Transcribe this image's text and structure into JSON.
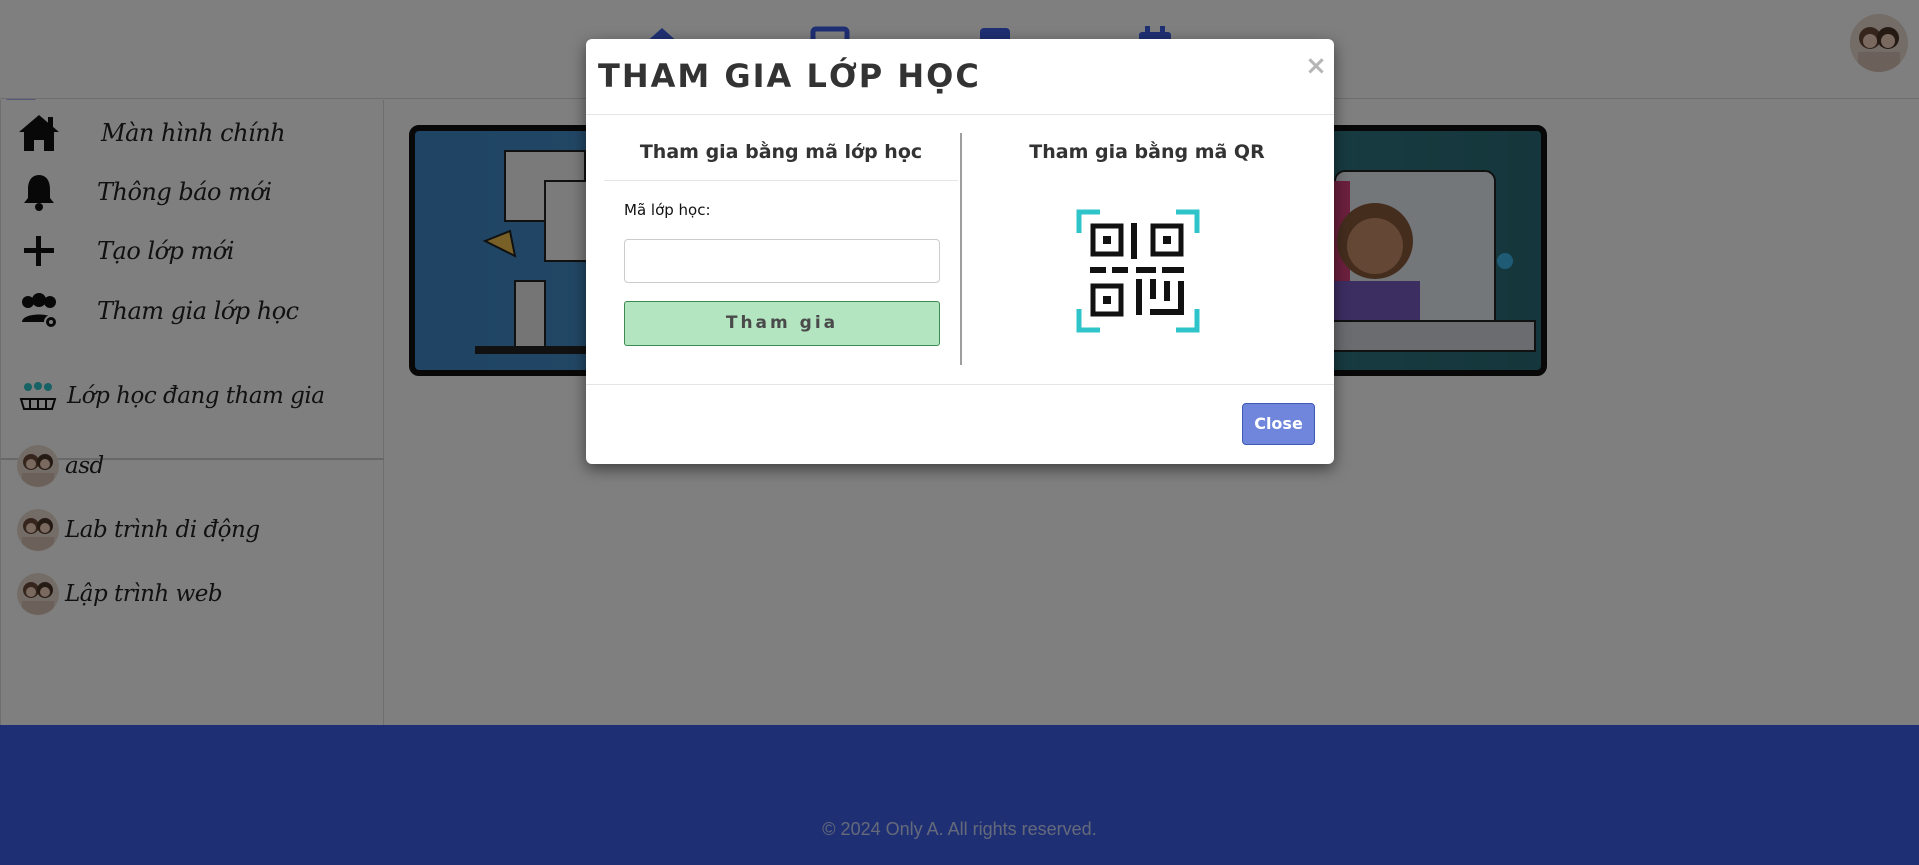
{
  "sidebar": {
    "items": [
      {
        "label": "Màn hình chính",
        "icon": "home-icon"
      },
      {
        "label": "Thông báo mới",
        "icon": "bell-icon"
      },
      {
        "label": "Tạo lớp mới",
        "icon": "plus-icon"
      },
      {
        "label": "Tham gia lớp học",
        "icon": "users-gear-icon"
      }
    ],
    "enrolled_header": "Lớp học đang tham gia",
    "classes": [
      {
        "label": "asd"
      },
      {
        "label": "Lab trình di động"
      },
      {
        "label": "Lập trình web"
      }
    ]
  },
  "footer": {
    "copyright": "© 2024 Only A. All rights reserved.",
    "icons": [
      "facebook-icon",
      "instagram-icon",
      "github-icon",
      "linkedin-icon",
      "email-icon"
    ]
  },
  "modal": {
    "title": "THAM GIA LỚP HỌC",
    "close_x": "×",
    "left_heading": "Tham gia bằng mã lớp học",
    "code_label": "Mã lớp học:",
    "code_value": "",
    "join_label": "Tham gia",
    "right_heading": "Tham gia bằng mã QR",
    "close_label": "Close"
  },
  "colors": {
    "footer": "#3f5fe6",
    "nav_icons": "#3f5fe6",
    "join_button": "#b3e5c1",
    "close_button": "#6f86dc",
    "qr_corners": "#2ec4c9"
  }
}
